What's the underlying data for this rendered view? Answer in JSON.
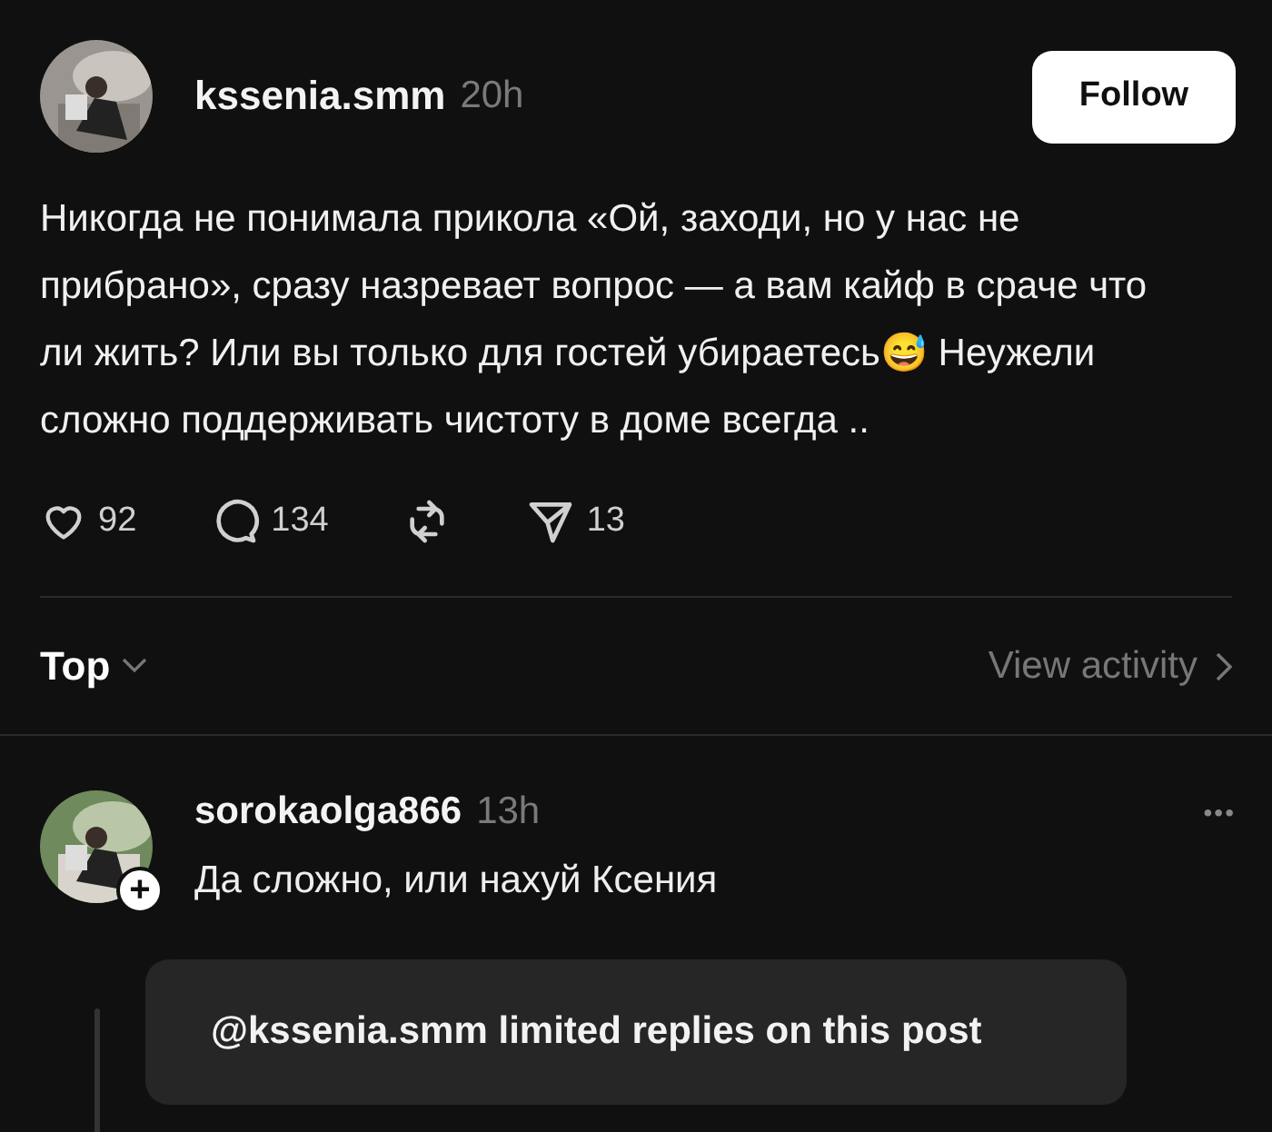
{
  "post": {
    "username": "kssenia.smm",
    "time": "20h",
    "follow_button": "Follow",
    "text": "Никогда не понимала прикола «Ой, заходи, но у нас не прибрано», сразу назревает вопрос — а вам кайф в сраче что ли жить? Или вы только для гостей убираетесь😅 Неужели сложно поддерживать чистоту в доме всегда ..",
    "actions": [
      {
        "kind": "like",
        "count": "92"
      },
      {
        "kind": "comment",
        "count": "134"
      },
      {
        "kind": "repost"
      },
      {
        "kind": "share",
        "count": "13"
      }
    ]
  },
  "sort": {
    "label": "Top",
    "view_activity": "View activity"
  },
  "reply": {
    "username": "sorokaolga866",
    "time": "13h",
    "more": "•••",
    "text": "Да сложно, или нахуй Ксения",
    "follow_badge": "+"
  },
  "toast": {
    "text": "@kssenia.smm limited replies on this post"
  }
}
